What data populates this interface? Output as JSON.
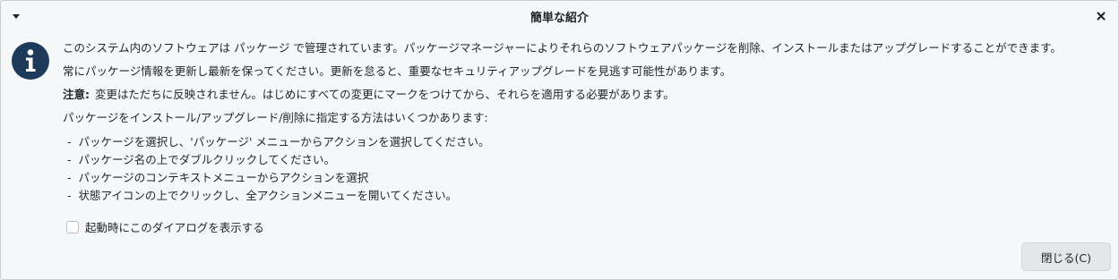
{
  "window": {
    "title": "簡単な紹介",
    "menu_icon": "chevron-down-icon",
    "close_icon": "close-icon"
  },
  "info_icon": "info-icon",
  "colors": {
    "accent": "#1e3a5a",
    "background": "#f6f7f9",
    "button_bg": "#e4e6e9"
  },
  "body": {
    "para1": "このシステム内のソフトウェアは  パッケージ  で管理されています。パッケージマネージャーによりそれらのソフトウェアパッケージを削除、インストールまたはアップグレードすることができます。",
    "para2": "常にパッケージ情報を更新し最新を保ってください。更新を怠ると、重要なセキュリティアップグレードを見逃す可能性があります。",
    "note_label": "注意:",
    "note_text": "変更はただちに反映されません。はじめにすべての変更にマークをつけてから、それらを適用する必要があります。",
    "para3": "パッケージをインストール/アップグレード/削除に指定する方法はいくつかあります:",
    "bullets": [
      "パッケージを選択し、'パッケージ'  メニューからアクションを選択してください。",
      "パッケージ名の上でダブルクリックしてください。",
      "パッケージのコンテキストメニューからアクションを選択",
      "状態アイコンの上でクリックし、全アクションメニューを開いてください。"
    ],
    "bullet_marker": "-"
  },
  "checkbox": {
    "label": "起動時にこのダイアログを表示する",
    "checked": false
  },
  "buttons": {
    "close_label": "閉じる(C)"
  }
}
